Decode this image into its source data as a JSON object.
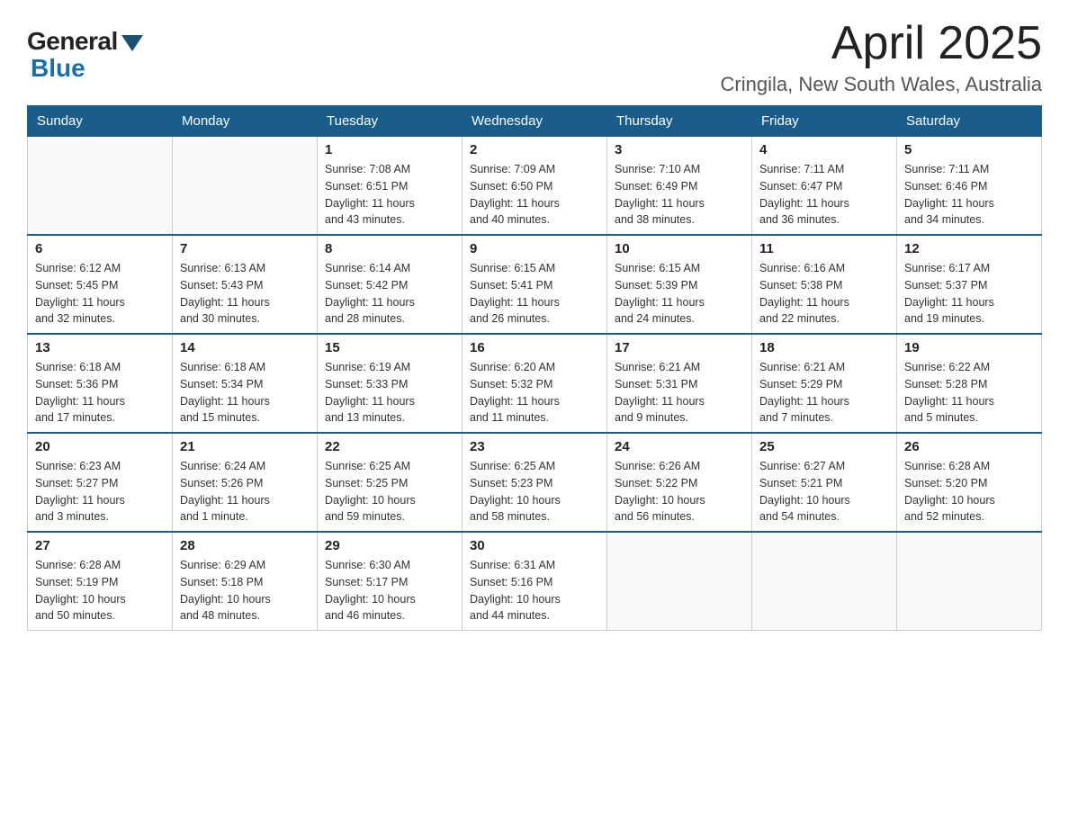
{
  "logo": {
    "general": "General",
    "blue": "Blue"
  },
  "title": "April 2025",
  "subtitle": "Cringila, New South Wales, Australia",
  "weekdays": [
    "Sunday",
    "Monday",
    "Tuesday",
    "Wednesday",
    "Thursday",
    "Friday",
    "Saturday"
  ],
  "weeks": [
    [
      {
        "day": "",
        "info": ""
      },
      {
        "day": "",
        "info": ""
      },
      {
        "day": "1",
        "info": "Sunrise: 7:08 AM\nSunset: 6:51 PM\nDaylight: 11 hours\nand 43 minutes."
      },
      {
        "day": "2",
        "info": "Sunrise: 7:09 AM\nSunset: 6:50 PM\nDaylight: 11 hours\nand 40 minutes."
      },
      {
        "day": "3",
        "info": "Sunrise: 7:10 AM\nSunset: 6:49 PM\nDaylight: 11 hours\nand 38 minutes."
      },
      {
        "day": "4",
        "info": "Sunrise: 7:11 AM\nSunset: 6:47 PM\nDaylight: 11 hours\nand 36 minutes."
      },
      {
        "day": "5",
        "info": "Sunrise: 7:11 AM\nSunset: 6:46 PM\nDaylight: 11 hours\nand 34 minutes."
      }
    ],
    [
      {
        "day": "6",
        "info": "Sunrise: 6:12 AM\nSunset: 5:45 PM\nDaylight: 11 hours\nand 32 minutes."
      },
      {
        "day": "7",
        "info": "Sunrise: 6:13 AM\nSunset: 5:43 PM\nDaylight: 11 hours\nand 30 minutes."
      },
      {
        "day": "8",
        "info": "Sunrise: 6:14 AM\nSunset: 5:42 PM\nDaylight: 11 hours\nand 28 minutes."
      },
      {
        "day": "9",
        "info": "Sunrise: 6:15 AM\nSunset: 5:41 PM\nDaylight: 11 hours\nand 26 minutes."
      },
      {
        "day": "10",
        "info": "Sunrise: 6:15 AM\nSunset: 5:39 PM\nDaylight: 11 hours\nand 24 minutes."
      },
      {
        "day": "11",
        "info": "Sunrise: 6:16 AM\nSunset: 5:38 PM\nDaylight: 11 hours\nand 22 minutes."
      },
      {
        "day": "12",
        "info": "Sunrise: 6:17 AM\nSunset: 5:37 PM\nDaylight: 11 hours\nand 19 minutes."
      }
    ],
    [
      {
        "day": "13",
        "info": "Sunrise: 6:18 AM\nSunset: 5:36 PM\nDaylight: 11 hours\nand 17 minutes."
      },
      {
        "day": "14",
        "info": "Sunrise: 6:18 AM\nSunset: 5:34 PM\nDaylight: 11 hours\nand 15 minutes."
      },
      {
        "day": "15",
        "info": "Sunrise: 6:19 AM\nSunset: 5:33 PM\nDaylight: 11 hours\nand 13 minutes."
      },
      {
        "day": "16",
        "info": "Sunrise: 6:20 AM\nSunset: 5:32 PM\nDaylight: 11 hours\nand 11 minutes."
      },
      {
        "day": "17",
        "info": "Sunrise: 6:21 AM\nSunset: 5:31 PM\nDaylight: 11 hours\nand 9 minutes."
      },
      {
        "day": "18",
        "info": "Sunrise: 6:21 AM\nSunset: 5:29 PM\nDaylight: 11 hours\nand 7 minutes."
      },
      {
        "day": "19",
        "info": "Sunrise: 6:22 AM\nSunset: 5:28 PM\nDaylight: 11 hours\nand 5 minutes."
      }
    ],
    [
      {
        "day": "20",
        "info": "Sunrise: 6:23 AM\nSunset: 5:27 PM\nDaylight: 11 hours\nand 3 minutes."
      },
      {
        "day": "21",
        "info": "Sunrise: 6:24 AM\nSunset: 5:26 PM\nDaylight: 11 hours\nand 1 minute."
      },
      {
        "day": "22",
        "info": "Sunrise: 6:25 AM\nSunset: 5:25 PM\nDaylight: 10 hours\nand 59 minutes."
      },
      {
        "day": "23",
        "info": "Sunrise: 6:25 AM\nSunset: 5:23 PM\nDaylight: 10 hours\nand 58 minutes."
      },
      {
        "day": "24",
        "info": "Sunrise: 6:26 AM\nSunset: 5:22 PM\nDaylight: 10 hours\nand 56 minutes."
      },
      {
        "day": "25",
        "info": "Sunrise: 6:27 AM\nSunset: 5:21 PM\nDaylight: 10 hours\nand 54 minutes."
      },
      {
        "day": "26",
        "info": "Sunrise: 6:28 AM\nSunset: 5:20 PM\nDaylight: 10 hours\nand 52 minutes."
      }
    ],
    [
      {
        "day": "27",
        "info": "Sunrise: 6:28 AM\nSunset: 5:19 PM\nDaylight: 10 hours\nand 50 minutes."
      },
      {
        "day": "28",
        "info": "Sunrise: 6:29 AM\nSunset: 5:18 PM\nDaylight: 10 hours\nand 48 minutes."
      },
      {
        "day": "29",
        "info": "Sunrise: 6:30 AM\nSunset: 5:17 PM\nDaylight: 10 hours\nand 46 minutes."
      },
      {
        "day": "30",
        "info": "Sunrise: 6:31 AM\nSunset: 5:16 PM\nDaylight: 10 hours\nand 44 minutes."
      },
      {
        "day": "",
        "info": ""
      },
      {
        "day": "",
        "info": ""
      },
      {
        "day": "",
        "info": ""
      }
    ]
  ]
}
